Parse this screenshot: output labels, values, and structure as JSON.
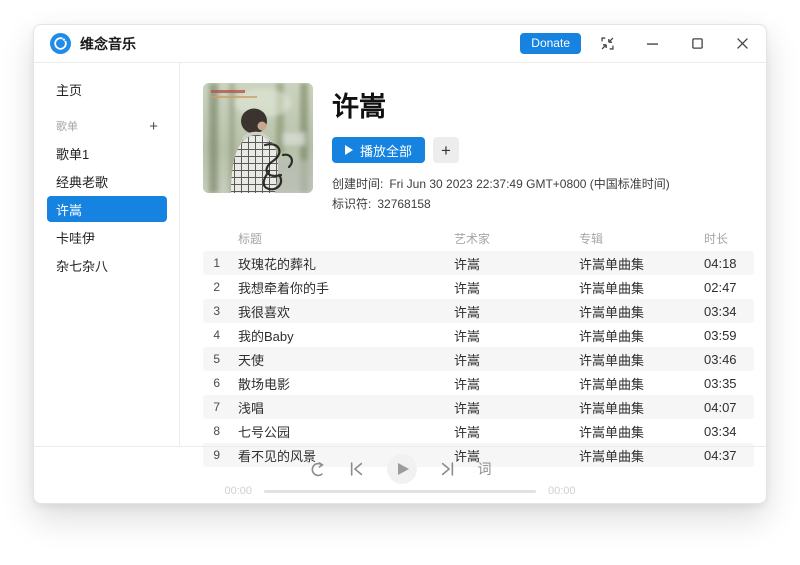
{
  "colors": {
    "accent": "#1583df",
    "logo_blue": "#1e8ce8",
    "row_stripe": "#f6f6f6"
  },
  "titlebar": {
    "app_title": "维念音乐",
    "donate_label": "Donate"
  },
  "sidebar": {
    "home_label": "主页",
    "section_label": "歌单",
    "add_label": "+",
    "playlists": [
      {
        "label": "歌单1",
        "selected": false
      },
      {
        "label": "经典老歌",
        "selected": false
      },
      {
        "label": "许嵩",
        "selected": true
      },
      {
        "label": "卡哇伊",
        "selected": false
      },
      {
        "label": "杂七杂八",
        "selected": false
      }
    ]
  },
  "playlist_header": {
    "title": "许嵩",
    "play_all_label": "播放全部",
    "add_label": "+",
    "created_label": "创建时间:",
    "created_value": "Fri Jun 30 2023 22:37:49 GMT+0800 (中国标准时间)",
    "id_label": "标识符:",
    "id_value": "32768158"
  },
  "table": {
    "columns": [
      "标题",
      "艺术家",
      "专辑",
      "时长"
    ],
    "rows": [
      {
        "no": "1",
        "title": "玫瑰花的葬礼",
        "artist": "许嵩",
        "album": "许嵩单曲集",
        "duration": "04:18"
      },
      {
        "no": "2",
        "title": "我想牵着你的手",
        "artist": "许嵩",
        "album": "许嵩单曲集",
        "duration": "02:47"
      },
      {
        "no": "3",
        "title": "我很喜欢",
        "artist": "许嵩",
        "album": "许嵩单曲集",
        "duration": "03:34"
      },
      {
        "no": "4",
        "title": "我的Baby",
        "artist": "许嵩",
        "album": "许嵩单曲集",
        "duration": "03:59"
      },
      {
        "no": "5",
        "title": "天使",
        "artist": "许嵩",
        "album": "许嵩单曲集",
        "duration": "03:46"
      },
      {
        "no": "6",
        "title": "散场电影",
        "artist": "许嵩",
        "album": "许嵩单曲集",
        "duration": "03:35"
      },
      {
        "no": "7",
        "title": "浅唱",
        "artist": "许嵩",
        "album": "许嵩单曲集",
        "duration": "04:07"
      },
      {
        "no": "8",
        "title": "七号公园",
        "artist": "许嵩",
        "album": "许嵩单曲集",
        "duration": "03:34"
      },
      {
        "no": "9",
        "title": "看不见的风景",
        "artist": "许嵩",
        "album": "许嵩单曲集",
        "duration": "04:37"
      }
    ]
  },
  "player": {
    "lyrics_label": "词",
    "current_time": "00:00",
    "total_time": "00:00"
  }
}
